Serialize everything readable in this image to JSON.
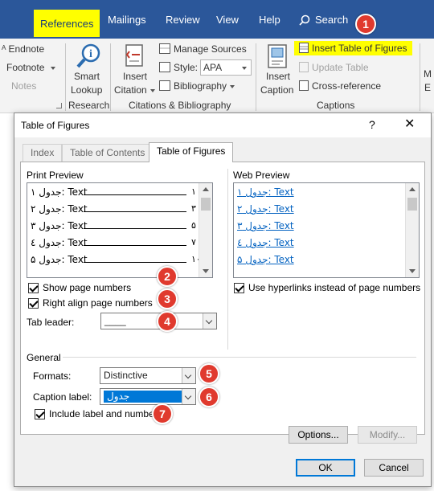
{
  "ribbon_tabs": [
    "References",
    "Mailings",
    "Review",
    "View",
    "Help"
  ],
  "search_label": "Search",
  "ribbon": {
    "footnotes": {
      "endnote": "Endnote",
      "footnote": "Footnote",
      "notes": "Notes"
    },
    "research": {
      "smart": "Smart",
      "lookup": "Lookup",
      "group": "Research"
    },
    "citations": {
      "insert": "Insert",
      "citation": "Citation",
      "manage_sources": "Manage Sources",
      "style_label": "Style:",
      "style_value": "APA",
      "bibliography": "Bibliography",
      "group": "Citations & Bibliography"
    },
    "captions": {
      "insert": "Insert",
      "caption": "Caption",
      "insert_tof": "Insert Table of Figures",
      "update_table": "Update Table",
      "cross_reference": "Cross-reference",
      "group": "Captions"
    },
    "index_partial": {
      "m": "M",
      "e": "E"
    }
  },
  "badges": [
    "1",
    "2",
    "3",
    "4",
    "5",
    "6",
    "7"
  ],
  "dialog": {
    "title": "Table of Figures",
    "help": "?",
    "close": "✕",
    "tabs": [
      "Index",
      "Table of Contents",
      "Table of Figures"
    ],
    "print_preview_label": "Print Preview",
    "web_preview_label": "Web Preview",
    "print_rows": [
      {
        "caption": "جدول ۱: Text",
        "page": "۱"
      },
      {
        "caption": "جدول ۲: Text",
        "page": "۳"
      },
      {
        "caption": "جدول ۳: Text",
        "page": "۵"
      },
      {
        "caption": "جدول ٤: Text",
        "page": "۷"
      },
      {
        "caption": "جدول ۵: Text",
        "page": "۱۰"
      }
    ],
    "web_rows": [
      "جدول ۱: Text",
      "جدول ۲: Text",
      "جدول ۳: Text",
      "جدول ٤: Text",
      "جدول ۵: Text"
    ],
    "show_page_numbers": "Show page numbers",
    "right_align": "Right align page numbers",
    "tab_leader_label": "Tab leader:",
    "tab_leader_value": "____",
    "use_hyperlinks": "Use hyperlinks instead of page numbers",
    "general_label": "General",
    "formats_label": "Formats:",
    "formats_value": "Distinctive",
    "caption_label_label": "Caption label:",
    "caption_label_value": "جدول",
    "include_label": "Include label and number",
    "options_btn": "Options...",
    "modify_btn": "Modify...",
    "ok_btn": "OK",
    "cancel_btn": "Cancel"
  }
}
